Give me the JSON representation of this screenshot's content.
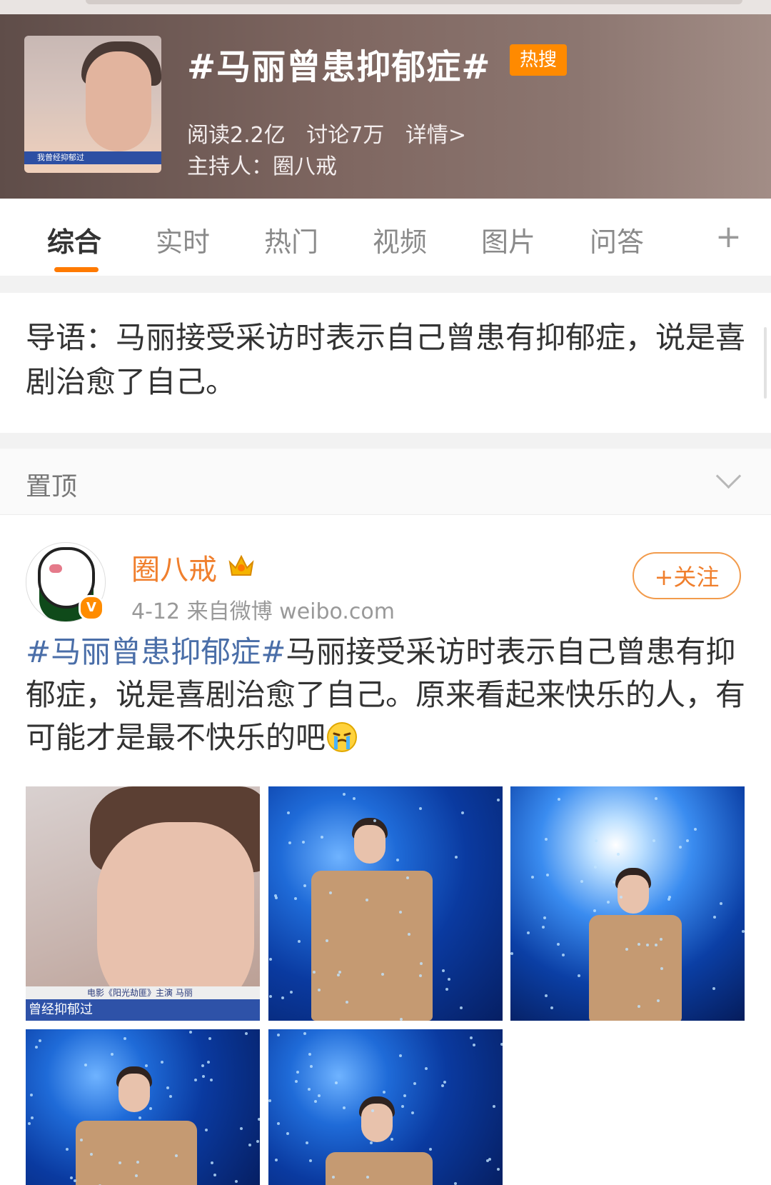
{
  "topic": {
    "title": "#马丽曾患抑郁症#",
    "badge": "热搜",
    "reads": "阅读2.2亿",
    "discussions": "讨论7万",
    "details": "详情>",
    "host": "主持人：圈八戒",
    "thumb_caption": "我曾经抑郁过"
  },
  "tabs": [
    {
      "label": "综合"
    },
    {
      "label": "实时"
    },
    {
      "label": "热门"
    },
    {
      "label": "视频"
    },
    {
      "label": "图片"
    },
    {
      "label": "问答"
    }
  ],
  "tab_more": "+",
  "intro": {
    "text": "导语：马丽接受采访时表示自己曾患有抑郁症，说是喜剧治愈了自己。"
  },
  "pinned": {
    "label": "置顶"
  },
  "post": {
    "author": "圈八戒",
    "meta": "4-12  来自微博 weibo.com",
    "follow": "+关注",
    "hashtag": "#马丽曾患抑郁症#",
    "text": "马丽接受采访时表示自己曾患有抑郁症，说是喜剧治愈了自己。原来看起来快乐的人，有可能才是最不快乐的吧",
    "photo1_caption_top": "电影《阳光劫匪》主演 马丽",
    "photo1_caption": "曾经抑郁过"
  },
  "colors": {
    "accent": "#ff8a00",
    "author": "#f07f2d",
    "hashtag": "#4a6ea8"
  },
  "icons": [
    "crown-icon",
    "verified-icon",
    "crying-emoji-icon",
    "chevron-down-icon",
    "plus-icon"
  ]
}
